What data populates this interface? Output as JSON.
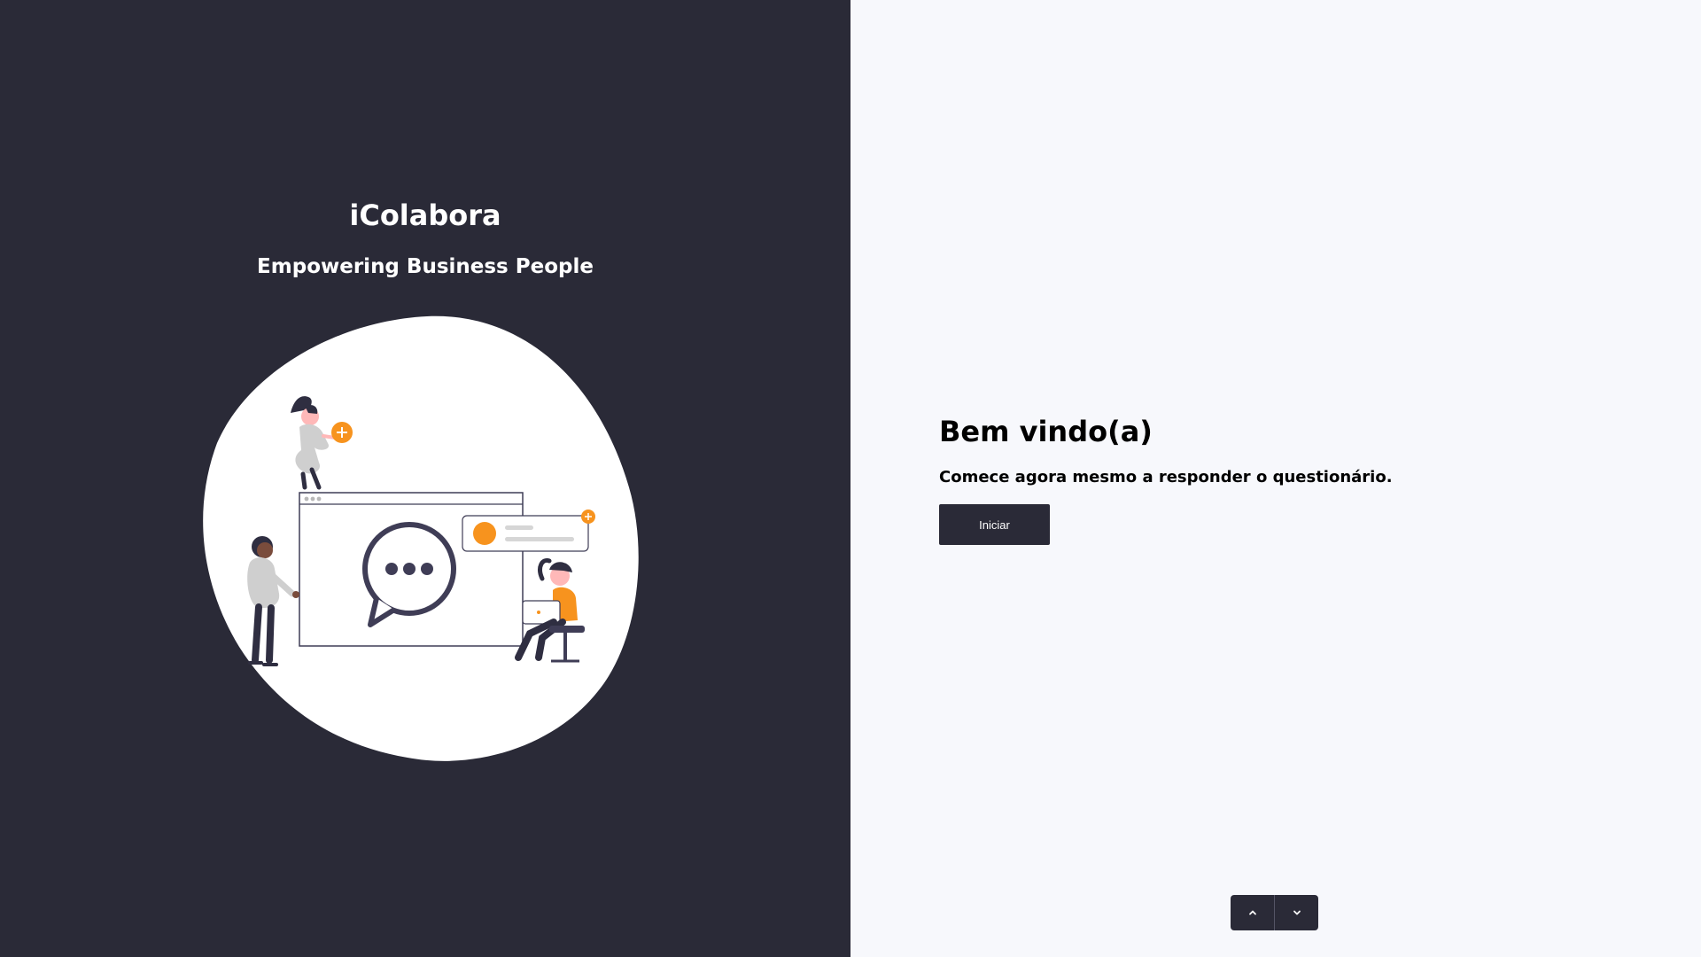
{
  "brand": {
    "title": "iColabora",
    "tagline": "Empowering Business People"
  },
  "welcome": {
    "title": "Bem vindo(a)",
    "subtitle": "Comece agora mesmo a responder o questionário.",
    "start_label": "Iniciar"
  },
  "navigation": {
    "up_icon": "chevron-up-icon",
    "down_icon": "chevron-down-icon"
  },
  "colors": {
    "dark": "#2a2a37",
    "light_bg": "#f7f8fc",
    "accent": "#f7931e"
  }
}
